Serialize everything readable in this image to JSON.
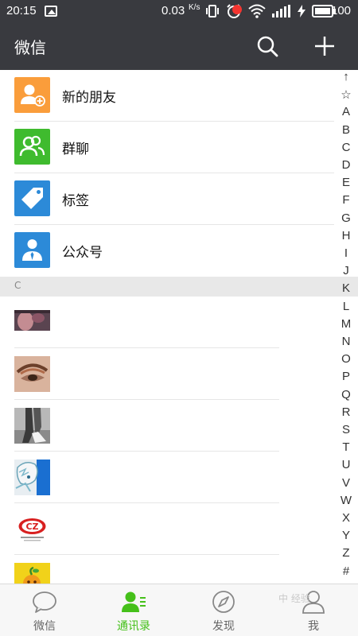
{
  "status_bar": {
    "time": "20:15",
    "speed": "0.03",
    "speed_unit": "K/s",
    "battery": "100"
  },
  "app_bar": {
    "title": "微信",
    "search_icon": "search-icon",
    "add_icon": "plus-icon"
  },
  "functions": [
    {
      "label": "新的朋友",
      "icon": "new-friend-icon",
      "color": "#fa9d3b"
    },
    {
      "label": "群聊",
      "icon": "group-chat-icon",
      "color": "#3fbb2e"
    },
    {
      "label": "标签",
      "icon": "tag-icon",
      "color": "#2c8ad8"
    },
    {
      "label": "公众号",
      "icon": "official-account-icon",
      "color": "#2c8ad8"
    }
  ],
  "section": {
    "letter": "C"
  },
  "contacts": [
    {
      "avatar": "photo-avatar"
    },
    {
      "avatar": "eye-makeup-avatar"
    },
    {
      "avatar": "legs-photo-avatar"
    },
    {
      "avatar": "anime-character-avatar"
    },
    {
      "avatar": "cz-logo-avatar",
      "logo_text": "CZ"
    },
    {
      "avatar": "orange-cartoon-avatar"
    }
  ],
  "index_bar": [
    "↑",
    "☆",
    "A",
    "B",
    "C",
    "D",
    "E",
    "F",
    "G",
    "H",
    "I",
    "J",
    "K",
    "L",
    "M",
    "N",
    "O",
    "P",
    "Q",
    "R",
    "S",
    "T",
    "U",
    "V",
    "W",
    "X",
    "Y",
    "Z",
    "#"
  ],
  "tabs": [
    {
      "label": "微信",
      "icon": "chat-bubble-icon",
      "active": false
    },
    {
      "label": "通讯录",
      "icon": "contacts-icon",
      "active": true
    },
    {
      "label": "发现",
      "icon": "compass-icon",
      "active": false,
      "badge": true
    },
    {
      "label": "我",
      "icon": "profile-icon",
      "active": false
    }
  ],
  "watermark": "中 经验"
}
